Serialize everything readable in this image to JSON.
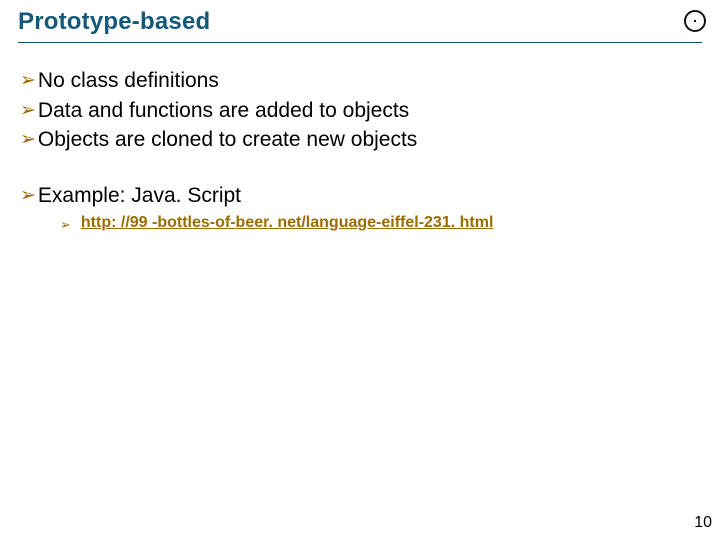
{
  "header": {
    "title": "Prototype-based"
  },
  "bullets": {
    "items": [
      {
        "text": "No class definitions"
      },
      {
        "text": "Data and functions are added to objects"
      },
      {
        "text": "Objects are cloned to create new objects"
      }
    ],
    "example_label": "Example: Java. Script",
    "link_text": "http: //99 -bottles-of-beer. net/language-eiffel-231. html"
  },
  "footer": {
    "page_number": "10"
  }
}
